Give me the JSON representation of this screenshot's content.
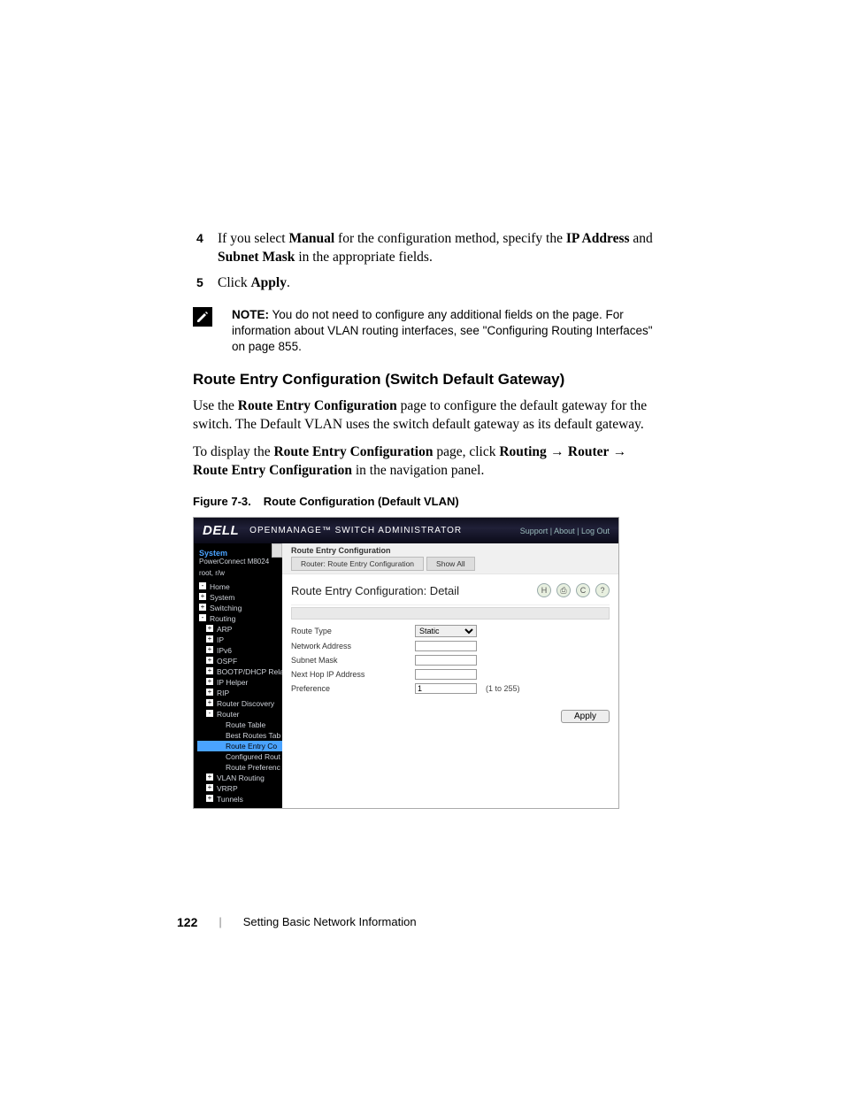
{
  "steps": {
    "s4_num": "4",
    "s4_pre": "If you select ",
    "s4_b1": "Manual",
    "s4_mid1": " for the configuration method, specify the ",
    "s4_b2": "IP Address",
    "s4_mid2": " and ",
    "s4_b3": "Subnet Mask",
    "s4_post": " in the appropriate fields.",
    "s5_num": "5",
    "s5_pre": "Click ",
    "s5_b1": "Apply",
    "s5_post": "."
  },
  "note": {
    "label": "NOTE:",
    "text": " You do not need to configure any additional fields on the page. For information about VLAN routing interfaces, see \"Configuring Routing Interfaces\" on page 855."
  },
  "section_heading": "Route Entry Configuration (Switch Default Gateway)",
  "para1": {
    "pre": "Use the ",
    "b1": "Route Entry Configuration",
    "post": " page to configure the default gateway for the switch. The Default VLAN uses the switch default gateway as its default gateway."
  },
  "para2": {
    "pre": "To display the ",
    "b1": "Route Entry Configuration",
    "mid1": " page, click ",
    "b2": "Routing",
    "arrow": " → ",
    "b3": "Router",
    "b4": "Route Entry Configuration",
    "post": " in the navigation panel."
  },
  "figure": {
    "num": "Figure 7-3.",
    "title": "Route Configuration (Default VLAN)"
  },
  "screenshot": {
    "banner": {
      "logo": "DELL",
      "title": "OPENMANAGE™ SWITCH ADMINISTRATOR",
      "links": "Support | About | Log Out"
    },
    "nav": {
      "system": "System",
      "product": "PowerConnect M8024",
      "user": "root, r/w",
      "items": [
        {
          "label": "Home",
          "cls": "minus"
        },
        {
          "label": "System",
          "cls": "plus"
        },
        {
          "label": "Switching",
          "cls": "plus"
        },
        {
          "label": "Routing",
          "cls": "minus"
        },
        {
          "label": "ARP",
          "cls": "plus l2"
        },
        {
          "label": "IP",
          "cls": "plus l2"
        },
        {
          "label": "IPv6",
          "cls": "plus l2"
        },
        {
          "label": "OSPF",
          "cls": "plus l2"
        },
        {
          "label": "BOOTP/DHCP Relay",
          "cls": "plus l2"
        },
        {
          "label": "IP Helper",
          "cls": "plus l2"
        },
        {
          "label": "RIP",
          "cls": "plus l2"
        },
        {
          "label": "Router Discovery",
          "cls": "plus l2"
        },
        {
          "label": "Router",
          "cls": "minus l2"
        },
        {
          "label": "Route Table",
          "cls": "nobox l3"
        },
        {
          "label": "Best Routes Tab",
          "cls": "nobox l3"
        },
        {
          "label": "Route Entry Co",
          "cls": "nobox l3 sel"
        },
        {
          "label": "Configured Rout",
          "cls": "nobox l3"
        },
        {
          "label": "Route Preferenc",
          "cls": "nobox l3"
        },
        {
          "label": "VLAN Routing",
          "cls": "plus l2"
        },
        {
          "label": "VRRP",
          "cls": "plus l2"
        },
        {
          "label": "Tunnels",
          "cls": "plus l2"
        }
      ]
    },
    "main": {
      "crumb_title": "Route Entry Configuration",
      "tab1": "Router: Route Entry Configuration",
      "tab2": "Show All",
      "detail_title": "Route Entry Configuration: Detail",
      "icons": {
        "h": "H",
        "print": "⎙",
        "refresh": "C",
        "help": "?"
      },
      "form": {
        "route_type_label": "Route Type",
        "route_type_value": "Static",
        "network_address_label": "Network Address",
        "network_address_value": "",
        "subnet_mask_label": "Subnet Mask",
        "subnet_mask_value": "",
        "next_hop_label": "Next Hop IP Address",
        "next_hop_value": "",
        "preference_label": "Preference",
        "preference_value": "1",
        "preference_range": "(1 to 255)"
      },
      "apply_label": "Apply"
    }
  },
  "footer": {
    "page_number": "122",
    "divider": "|",
    "chapter": "Setting Basic Network Information"
  }
}
